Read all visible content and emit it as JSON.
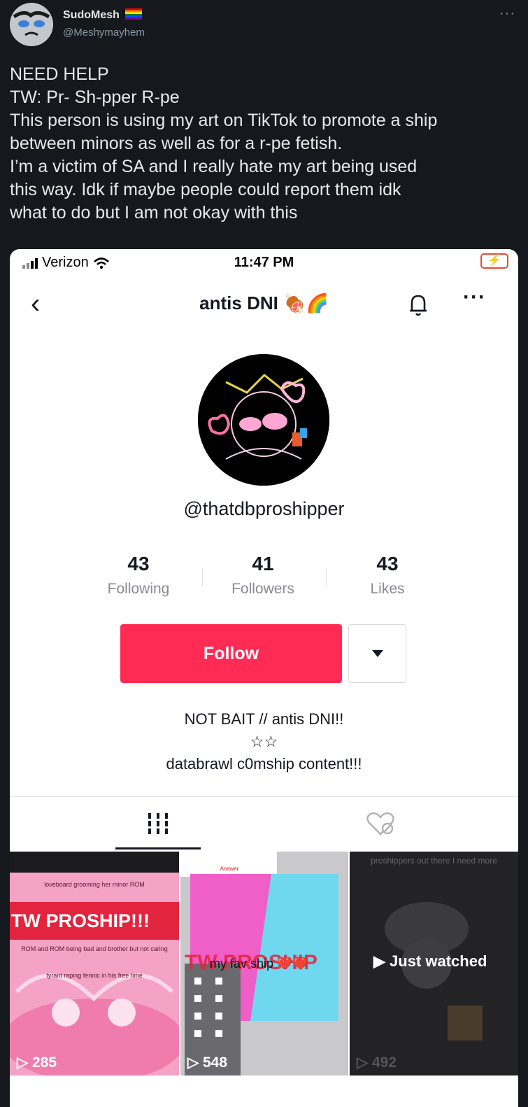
{
  "tweet": {
    "author_name": "SudoMesh",
    "handle": "@Meshymayhem",
    "more": "···",
    "lines": [
      "NEED HELP",
      "TW: Pr- Sh-pper R-pe",
      "This person is using my art on TikTok to promote a ship",
      "between minors as well as for a r-pe fetish.",
      "I’m a victim of SA and I really hate my art being used",
      "this way. Idk if maybe people could report them idk",
      "what to do but I am not okay with this"
    ]
  },
  "phone": {
    "carrier": "Verizon",
    "time": "11:47 PM",
    "battery_icon": "charging-battery-icon"
  },
  "profile": {
    "back": "‹",
    "title": "antis DNI 🍖🌈",
    "more": "···",
    "username": "@thatdbproshipper",
    "following_count": "43",
    "following_label": "Following",
    "followers_count": "41",
    "followers_label": "Followers",
    "likes_count": "43",
    "likes_label": "Likes",
    "follow_label": "Follow",
    "bio_line1": "NOT BAIT // antis DNI!!",
    "bio_line2": "☆☆",
    "bio_line3": "databrawl c0mship content!!!"
  },
  "videos": [
    {
      "views": "285",
      "banner": "TW PROSHIP!!!",
      "caption_top": "loveboard grooming her minor ROM",
      "caption_mid": "ROM and ROM being bad and brother but not caring",
      "caption_bot": "tyrant raping fennic in his free time"
    },
    {
      "views": "548",
      "overlay": "TW PROSHIP",
      "caption": "my fav ship 💔❤️",
      "answer": "Answer"
    },
    {
      "views": "492",
      "overlay": "▶ Just watched",
      "caption_top": "proshippers out there I need more"
    }
  ],
  "colors": {
    "follow_button": "#fe2c55",
    "tweet_bg": "#15181c"
  }
}
